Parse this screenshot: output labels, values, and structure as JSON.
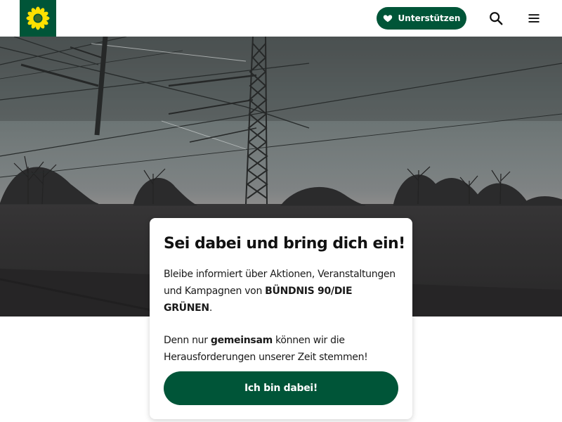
{
  "header": {
    "logo_name": "sunflower-logo",
    "support_label": "Unterstützen",
    "search_icon": "search-icon",
    "menu_icon": "menu-icon"
  },
  "hero": {
    "image_subject": "railway-overhead-lines-at-dusk"
  },
  "card": {
    "title": "Sei dabei und bring dich ein!",
    "p1_before": "Bleibe informiert über Aktionen, Veranstaltungen und Kampagnen von ",
    "p1_bold": "BÜNDNIS 90/DIE GRÜNEN",
    "p1_after": ".",
    "p2_before": "Denn nur ",
    "p2_bold": "gemeinsam",
    "p2_after": " können wir die Herausforderungen unserer Zeit stemmen!",
    "cta_label": "Ich bin dabei!"
  },
  "colors": {
    "brand_green": "#005538",
    "sunflower_yellow": "#ffe000",
    "text_dark": "#111111"
  }
}
